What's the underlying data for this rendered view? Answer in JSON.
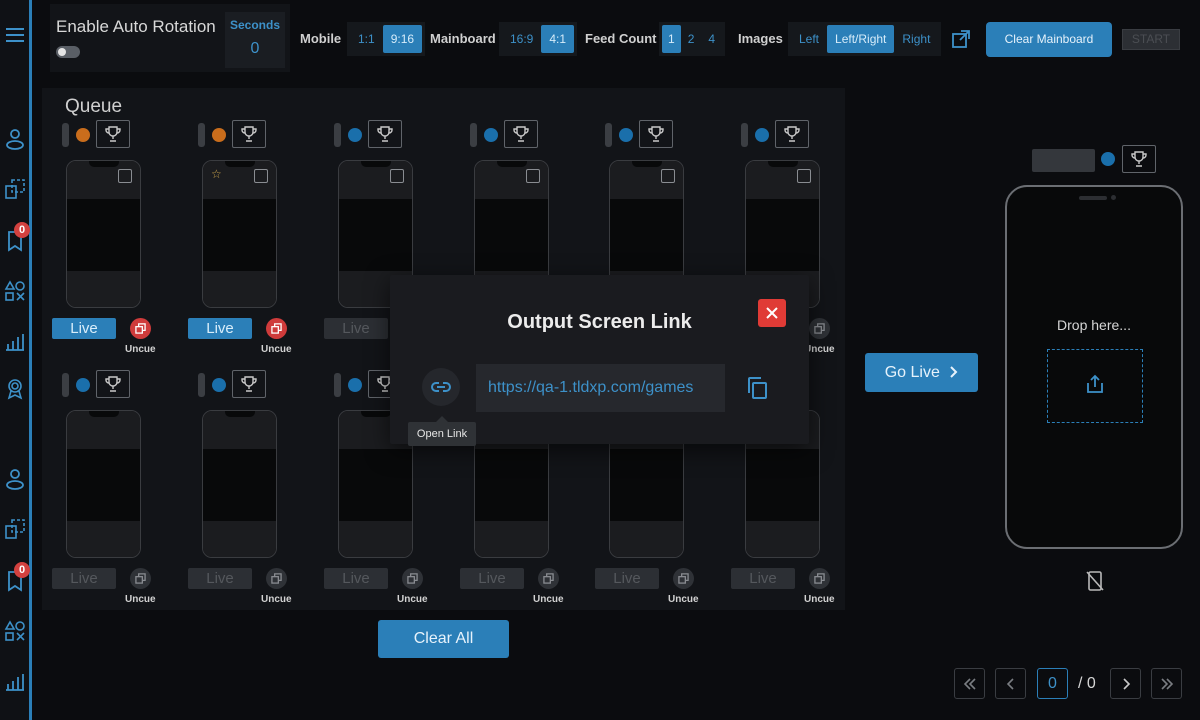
{
  "autorotation": {
    "title": "Enable Auto Rotation",
    "seconds_label": "Seconds",
    "seconds_value": "0"
  },
  "toolbar": {
    "mobile_label": "Mobile",
    "mobile_options": [
      "1:1",
      "9:16"
    ],
    "mainboard_label": "Mainboard",
    "mainboard_options": [
      "16:9",
      "4:1"
    ],
    "feedcount_label": "Feed Count",
    "feedcount_options": [
      "1",
      "2",
      "4"
    ],
    "images_label": "Images",
    "images_options": [
      "Left",
      "Left/Right",
      "Right"
    ],
    "clear_mainboard": "Clear Mainboard",
    "start": "START"
  },
  "queue": {
    "title": "Queue",
    "live_label": "Live",
    "uncue_label": "Uncue",
    "clear_all": "Clear All"
  },
  "go_live": "Go Live",
  "preview": {
    "drop_text": "Drop here..."
  },
  "sidebar": {
    "badge_count": "0"
  },
  "pagination": {
    "current": "0",
    "total": "/ 0"
  },
  "modal": {
    "title": "Output Screen Link",
    "url": "https://qa-1.tldxp.com/games",
    "tooltip": "Open Link"
  },
  "colors": {
    "accent": "#2b7fb8",
    "danger": "#e03b36",
    "orange_dot": "#c96d1c"
  }
}
